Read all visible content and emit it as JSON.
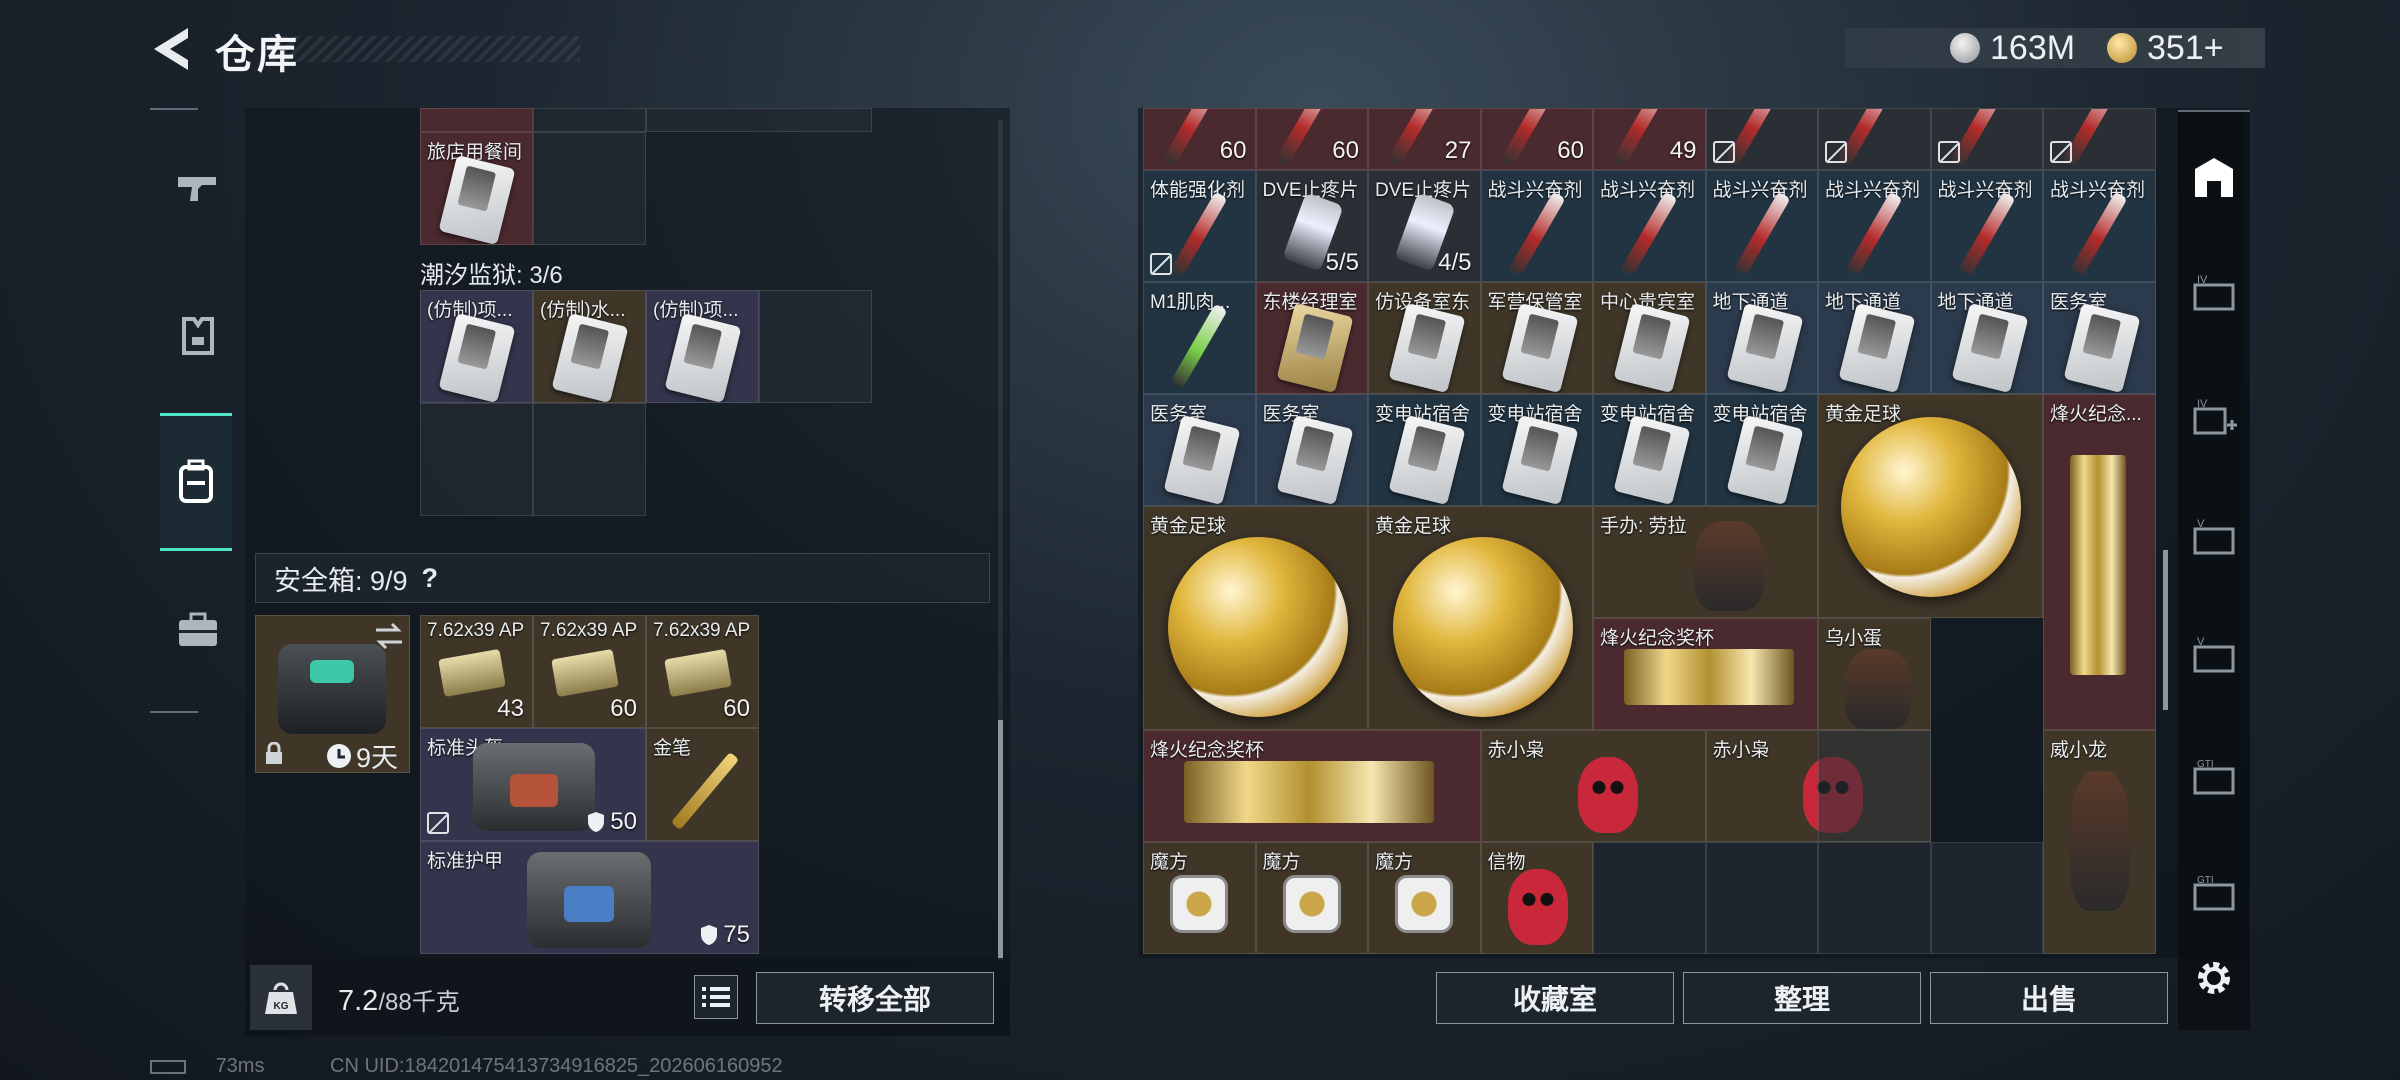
{
  "header": {
    "title": "仓库",
    "currency_silver": "163M",
    "currency_gold": "351+"
  },
  "left_panel": {
    "top_partial_item": "旅店用餐间",
    "section_title": "潮汐监狱: 3/6",
    "section_items": [
      "(仿制)项...",
      "(仿制)水...",
      "(仿制)项..."
    ],
    "safe_box": {
      "label": "安全箱: 9/9",
      "help": "?",
      "case_timer": "9天"
    },
    "safe_items": [
      {
        "label": "7.62x39 AP",
        "count": "43"
      },
      {
        "label": "7.62x39 AP",
        "count": "60"
      },
      {
        "label": "7.62x39 AP",
        "count": "60"
      },
      {
        "label": "标准头盔",
        "count": "50"
      },
      {
        "label": "金笔",
        "count": ""
      },
      {
        "label": "标准护甲",
        "count": "75"
      }
    ],
    "weight_current": "7.2",
    "weight_total": "/88千克",
    "kg_icon": "KG",
    "transfer_all": "转移全部"
  },
  "right_panel": {
    "row0_counts": [
      "60",
      "60",
      "27",
      "60",
      "49",
      "",
      "",
      "",
      ""
    ],
    "row1": [
      {
        "label": "体能强化剂",
        "count": ""
      },
      {
        "label": "DVE止疼片",
        "count": "5/5"
      },
      {
        "label": "DVE止疼片",
        "count": "4/5"
      },
      {
        "label": "战斗兴奋剂",
        "count": ""
      },
      {
        "label": "战斗兴奋剂",
        "count": ""
      },
      {
        "label": "战斗兴奋剂",
        "count": ""
      },
      {
        "label": "战斗兴奋剂",
        "count": ""
      },
      {
        "label": "战斗兴奋剂",
        "count": ""
      },
      {
        "label": "战斗兴奋剂",
        "count": ""
      }
    ],
    "row2": [
      "M1肌肉...",
      "东楼经理室",
      "仿设备室东",
      "军营保管室",
      "中心贵宾室",
      "地下通道",
      "地下通道",
      "地下通道",
      "医务室"
    ],
    "row3": [
      "医务室",
      "医务室",
      "变电站宿舍",
      "变电站宿舍",
      "变电站宿舍",
      "变电站宿舍",
      "黄金足球",
      "烽火纪念..."
    ],
    "big_items": {
      "ball_a": "黄金足球",
      "ball_b": "黄金足球",
      "figure_lara": "手办: 劳拉",
      "trophy_a": "烽火纪念奖杯",
      "egg": "乌小蛋",
      "trophy_b": "烽火纪念奖杯",
      "owl_a": "赤小枭",
      "owl_b": "赤小枭",
      "weixiaolong": "威小龙"
    },
    "bottom_row": [
      "魔方",
      "魔方",
      "魔方",
      "信物"
    ],
    "buttons": {
      "collection": "收藏室",
      "organize": "整理",
      "sell": "出售"
    }
  },
  "status": {
    "ping": "73ms",
    "uid": "CN UID:1842014754137349168​25_202606160952"
  }
}
